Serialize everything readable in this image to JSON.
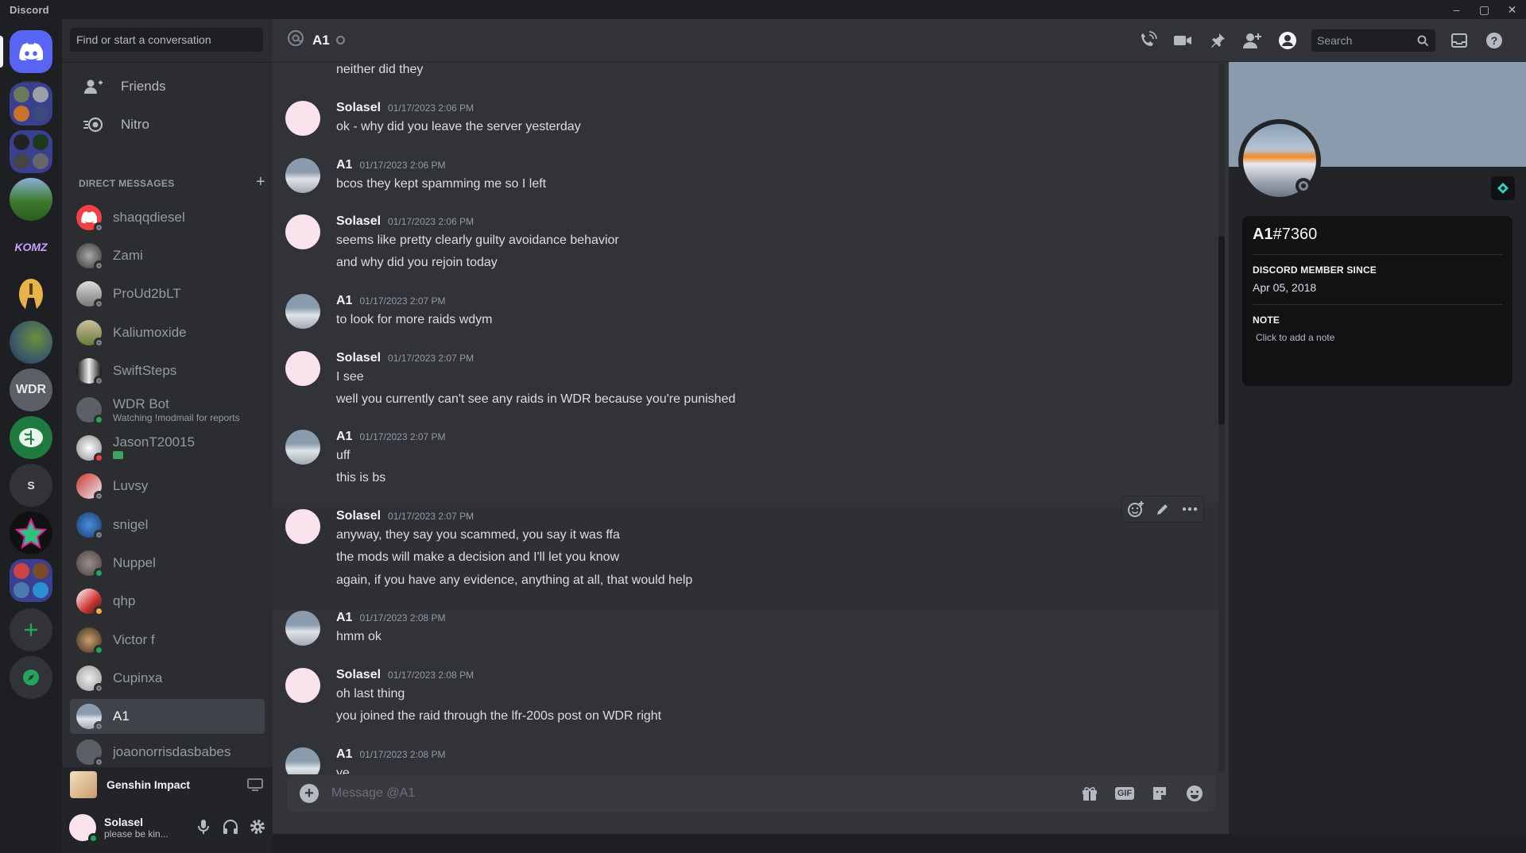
{
  "window": {
    "title": "Discord",
    "controls": [
      "–",
      "▢",
      "✕"
    ]
  },
  "dm_sidebar": {
    "search_placeholder": "Find or start a conversation",
    "nav": [
      {
        "label": "Friends"
      },
      {
        "label": "Nitro"
      }
    ],
    "section_title": "DIRECT MESSAGES",
    "add_dm": "+",
    "dms": [
      {
        "name": "shaqqdiesel",
        "status": "off"
      },
      {
        "name": "Zami",
        "status": "off"
      },
      {
        "name": "ProUd2bLT",
        "status": "off"
      },
      {
        "name": "Kaliumoxide",
        "status": "off"
      },
      {
        "name": "SwiftSteps",
        "status": "off"
      },
      {
        "name": "WDR Bot",
        "sub": "Watching !modmail for reports",
        "status": "on"
      },
      {
        "name": "JasonT20015",
        "status": "dnd"
      },
      {
        "name": "Luvsy",
        "status": "off"
      },
      {
        "name": "snigel",
        "status": "off"
      },
      {
        "name": "Nuppel",
        "status": "on"
      },
      {
        "name": "qhp",
        "status": "idle"
      },
      {
        "name": "Victor f",
        "status": "on"
      },
      {
        "name": "Cupinxa",
        "status": "off"
      },
      {
        "name": "A1",
        "status": "off",
        "active": true
      },
      {
        "name": "joaonorrisdasbabes",
        "status": "off"
      }
    ],
    "activity": {
      "game": "Genshin Impact"
    },
    "user": {
      "name": "Solasel",
      "status_text": "please be kin..."
    }
  },
  "chat": {
    "recipient": "A1",
    "search_placeholder": "Search",
    "composer_placeholder": "Message @A1",
    "gif_label": "GIF",
    "messages": [
      {
        "lines": [
          "neither did they"
        ]
      },
      {
        "author": "Solasel",
        "time": "01/17/2023 2:06 PM",
        "lines": [
          "ok - why did you leave the server yesterday"
        ]
      },
      {
        "author": "A1",
        "time": "01/17/2023 2:06 PM",
        "lines": [
          "bcos they kept spamming me so I left"
        ]
      },
      {
        "author": "Solasel",
        "time": "01/17/2023 2:06 PM",
        "lines": [
          "seems like pretty clearly guilty avoidance behavior",
          "and why did you rejoin today"
        ]
      },
      {
        "author": "A1",
        "time": "01/17/2023 2:07 PM",
        "lines": [
          "to look for more raids wdym"
        ]
      },
      {
        "author": "Solasel",
        "time": "01/17/2023 2:07 PM",
        "lines": [
          "I see",
          "well you currently can't see any raids in WDR because you're punished"
        ]
      },
      {
        "author": "A1",
        "time": "01/17/2023 2:07 PM",
        "lines": [
          "uff",
          "this is bs"
        ]
      },
      {
        "author": "Solasel",
        "time": "01/17/2023 2:07 PM",
        "lines": [
          "anyway, they say you scammed, you say it was ffa",
          "the mods will make a decision and I'll let you know",
          "again, if you have any evidence, anything at all, that would help"
        ]
      },
      {
        "author": "A1",
        "time": "01/17/2023 2:08 PM",
        "lines": [
          "hmm ok"
        ]
      },
      {
        "author": "Solasel",
        "time": "01/17/2023 2:08 PM",
        "lines": [
          "oh last thing",
          "you joined the raid through the lfr-200s post on WDR right"
        ]
      },
      {
        "author": "A1",
        "time": "01/17/2023 2:08 PM",
        "lines": [
          "ye"
        ]
      }
    ]
  },
  "profile": {
    "username": "A1",
    "discriminator": "#7360",
    "member_since_label": "DISCORD MEMBER SINCE",
    "member_since": "Apr 05, 2018",
    "note_label": "NOTE",
    "note_placeholder": "Click to add a note"
  },
  "colors": {
    "brand": "#5865f2",
    "online": "#23a55a",
    "dnd": "#f23f43",
    "idle": "#f0b232",
    "offline": "#80848e"
  }
}
